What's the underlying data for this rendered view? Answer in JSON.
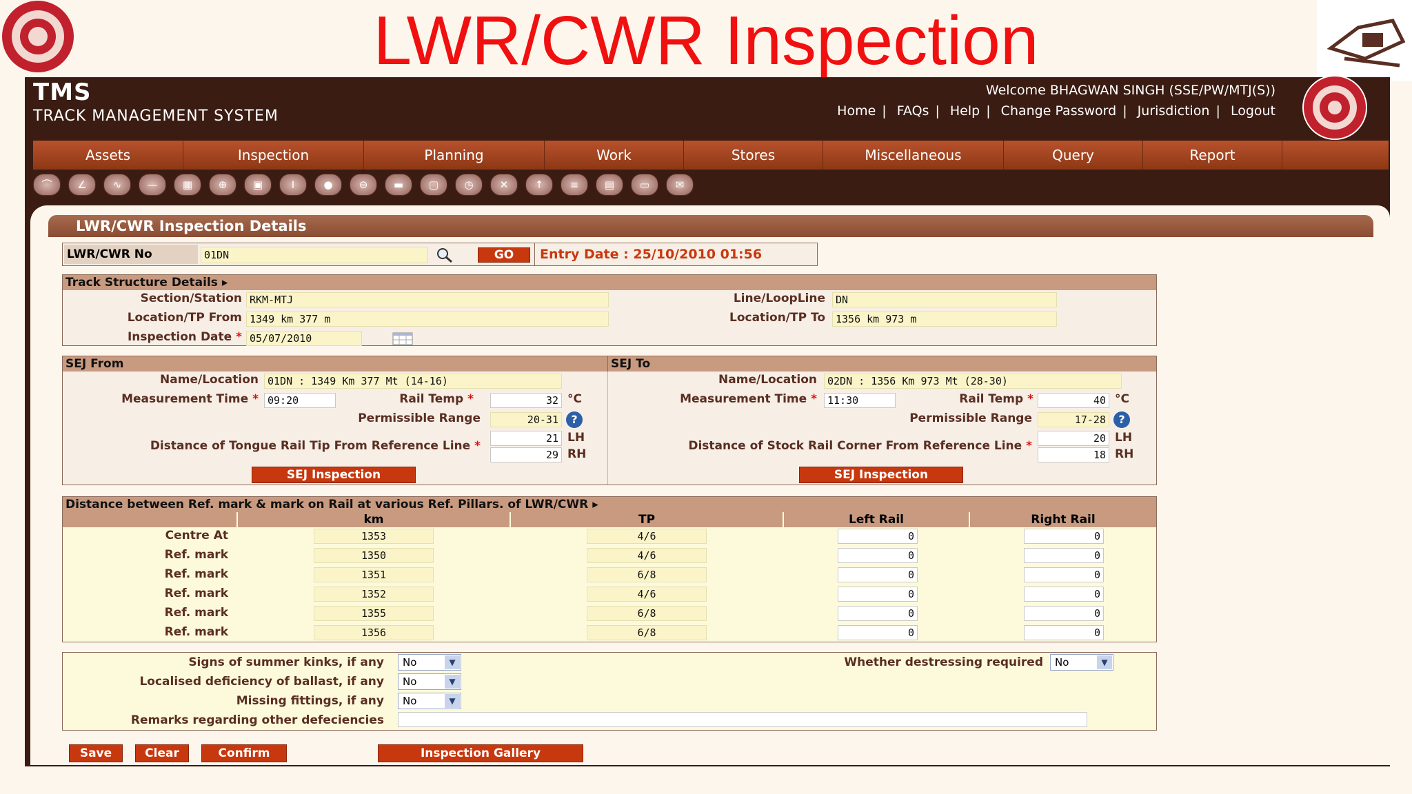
{
  "slide": {
    "title": "LWR/CWR Inspection"
  },
  "header": {
    "brand": "TMS",
    "brand_sub": "TRACK MANAGEMENT SYSTEM",
    "welcome": "Welcome BHAGWAN SINGH (SSE/PW/MTJ(S))",
    "links": [
      "Home",
      "FAQs",
      "Help",
      "Change Password",
      "Jurisdiction",
      "Logout"
    ]
  },
  "menu": [
    "Assets",
    "Inspection",
    "Planning",
    "Work",
    "Stores",
    "Miscellaneous",
    "Query",
    "Report"
  ],
  "panel": {
    "title": "LWR/CWR Inspection Details"
  },
  "search": {
    "label": "LWR/CWR No",
    "value": "01DN",
    "go": "GO",
    "entry_date": "Entry Date : 25/10/2010 01:56"
  },
  "track": {
    "title": "Track Structure Details",
    "section_label": "Section/Station",
    "section": "RKM-MTJ",
    "line_label": "Line/LoopLine",
    "line": "DN",
    "from_label": "Location/TP From",
    "from": "1349 km 377 m",
    "to_label": "Location/TP To",
    "to": "1356 km 973 m",
    "date_label": "Inspection Date",
    "date": "05/07/2010"
  },
  "sej_from": {
    "title": "SEJ From",
    "name_label": "Name/Location",
    "name": "01DN : 1349 Km 377 Mt (14-16)",
    "time_label": "Measurement Time",
    "time": "09:20",
    "temp_label": "Rail Temp",
    "temp": "32",
    "unit": "°C",
    "range_label": "Permissible Range",
    "range": "20-31",
    "dist_label": "Distance of Tongue Rail Tip From Reference Line",
    "lh": "21",
    "rh": "29",
    "lh_label": "LH",
    "rh_label": "RH",
    "button": "SEJ Inspection"
  },
  "sej_to": {
    "title": "SEJ To",
    "name_label": "Name/Location",
    "name": "02DN : 1356 Km 973 Mt (28-30)",
    "time_label": "Measurement Time",
    "time": "11:30",
    "temp_label": "Rail Temp",
    "temp": "40",
    "unit": "°C",
    "range_label": "Permissible Range",
    "range": "17-28",
    "dist_label": "Distance of Stock Rail Corner From Reference Line",
    "lh": "20",
    "rh": "18",
    "lh_label": "LH",
    "rh_label": "RH",
    "button": "SEJ Inspection"
  },
  "distance": {
    "title": "Distance between Ref. mark & mark on Rail at various Ref. Pillars. of LWR/CWR",
    "cols": [
      "km",
      "TP",
      "Left Rail",
      "Right Rail"
    ],
    "rows": [
      {
        "label": "Centre At",
        "km": "1353",
        "tp": "4/6",
        "left": "0",
        "right": "0"
      },
      {
        "label": "Ref. mark",
        "km": "1350",
        "tp": "4/6",
        "left": "0",
        "right": "0"
      },
      {
        "label": "Ref. mark",
        "km": "1351",
        "tp": "6/8",
        "left": "0",
        "right": "0"
      },
      {
        "label": "Ref. mark",
        "km": "1352",
        "tp": "4/6",
        "left": "0",
        "right": "0"
      },
      {
        "label": "Ref. mark",
        "km": "1355",
        "tp": "6/8",
        "left": "0",
        "right": "0"
      },
      {
        "label": "Ref. mark",
        "km": "1356",
        "tp": "6/8",
        "left": "0",
        "right": "0"
      }
    ]
  },
  "checks": {
    "kinks_label": "Signs of summer kinks, if any",
    "kinks": "No",
    "destress_label": "Whether destressing required",
    "destress": "No",
    "ballast_label": "Localised deficiency of ballast, if any",
    "ballast": "No",
    "fittings_label": "Missing fittings, if any",
    "fittings": "No",
    "remarks_label": "Remarks regarding other defeciencies",
    "remarks": ""
  },
  "actions": {
    "save": "Save",
    "clear": "Clear",
    "confirm": "Confirm",
    "gallery": "Inspection Gallery"
  },
  "toolbar_icons": [
    "rail-icon",
    "sleeper-icon",
    "curve-icon",
    "joint-icon",
    "bridge-icon",
    "level-crossing-icon",
    "station-icon",
    "signal-icon",
    "ballast-icon",
    "tunnel-icon",
    "track-icon",
    "cabin-icon",
    "gauge-icon",
    "tools-icon",
    "pillar-icon",
    "lwr-icon",
    "book-icon",
    "report-icon",
    "mail-icon"
  ],
  "colors": {
    "title_red": "#f01010",
    "header_bg": "#3a1c12",
    "menu": "#a94520",
    "button": "#c8380e",
    "field": "#fbf4c8"
  }
}
